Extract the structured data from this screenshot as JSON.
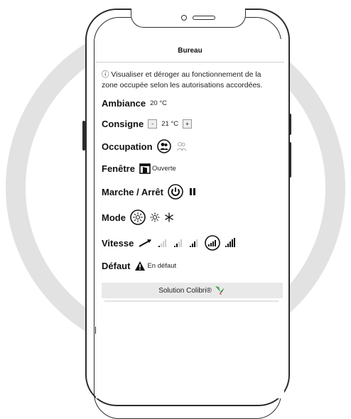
{
  "header": {
    "title": "Bureau"
  },
  "info_text": "ⓘ Visualiser et déroger au fonctionnement de la zone occupée selon les autorisations accordées.",
  "ambiance": {
    "label": "Ambiance",
    "value": "20 °C"
  },
  "consigne": {
    "label": "Consigne",
    "minus": "-",
    "value": "21 °C",
    "plus": "+"
  },
  "occupation": {
    "label": "Occupation",
    "icons": [
      "occupied-person-icon",
      "absent-persons-icon"
    ]
  },
  "fenetre": {
    "label": "Fenêtre",
    "value": "Ouverte",
    "icon": "window-open-icon"
  },
  "marche_arret": {
    "label": "Marche / Arrêt",
    "icons": [
      "power-icon",
      "pause-icon"
    ]
  },
  "mode": {
    "label": "Mode",
    "icons": [
      "auto-mode-icon",
      "sun-icon",
      "snowflake-icon"
    ]
  },
  "vitesse": {
    "label": "Vitesse",
    "icons": [
      "auto-speed-icon",
      "speed-1-icon",
      "speed-2-icon",
      "speed-3-icon",
      "speed-4-icon",
      "speed-5-icon"
    ]
  },
  "defaut": {
    "label": "Défaut",
    "value": "En défaut",
    "icon": "warning-icon"
  },
  "footer": {
    "label": "Solution Colibri®",
    "icon": "colibri-bird-icon"
  },
  "colors": {
    "accent_green": "#3fa34d",
    "accent_red": "#d23a3a",
    "ring": "#e2e2e2"
  }
}
